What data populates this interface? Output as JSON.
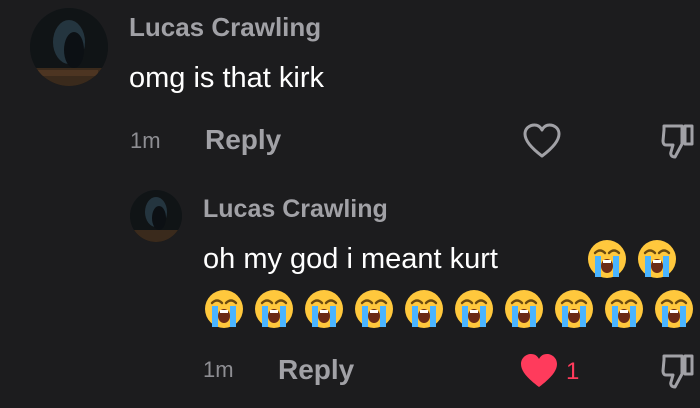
{
  "comment": {
    "username": "Lucas Crawling",
    "text": "omg is that kirk",
    "time": "1m",
    "reply_label": "Reply",
    "icons": {
      "avatar": "avatar-image",
      "like": "heart-outline-icon",
      "dislike": "thumbs-down-icon"
    }
  },
  "reply": {
    "username": "Lucas Crawling",
    "text": "oh my god i meant kurt",
    "emojis_inline": [
      "loudly-crying-face",
      "loudly-crying-face"
    ],
    "emojis_line": [
      "loudly-crying-face",
      "loudly-crying-face",
      "loudly-crying-face",
      "loudly-crying-face",
      "loudly-crying-face",
      "loudly-crying-face",
      "loudly-crying-face",
      "loudly-crying-face",
      "loudly-crying-face",
      "loudly-crying-face"
    ],
    "time": "1m",
    "reply_label": "Reply",
    "like_count": "1",
    "icons": {
      "avatar": "avatar-image",
      "like": "heart-filled-icon",
      "dislike": "thumbs-down-icon"
    },
    "colors": {
      "liked": "#ff3b5c"
    }
  }
}
